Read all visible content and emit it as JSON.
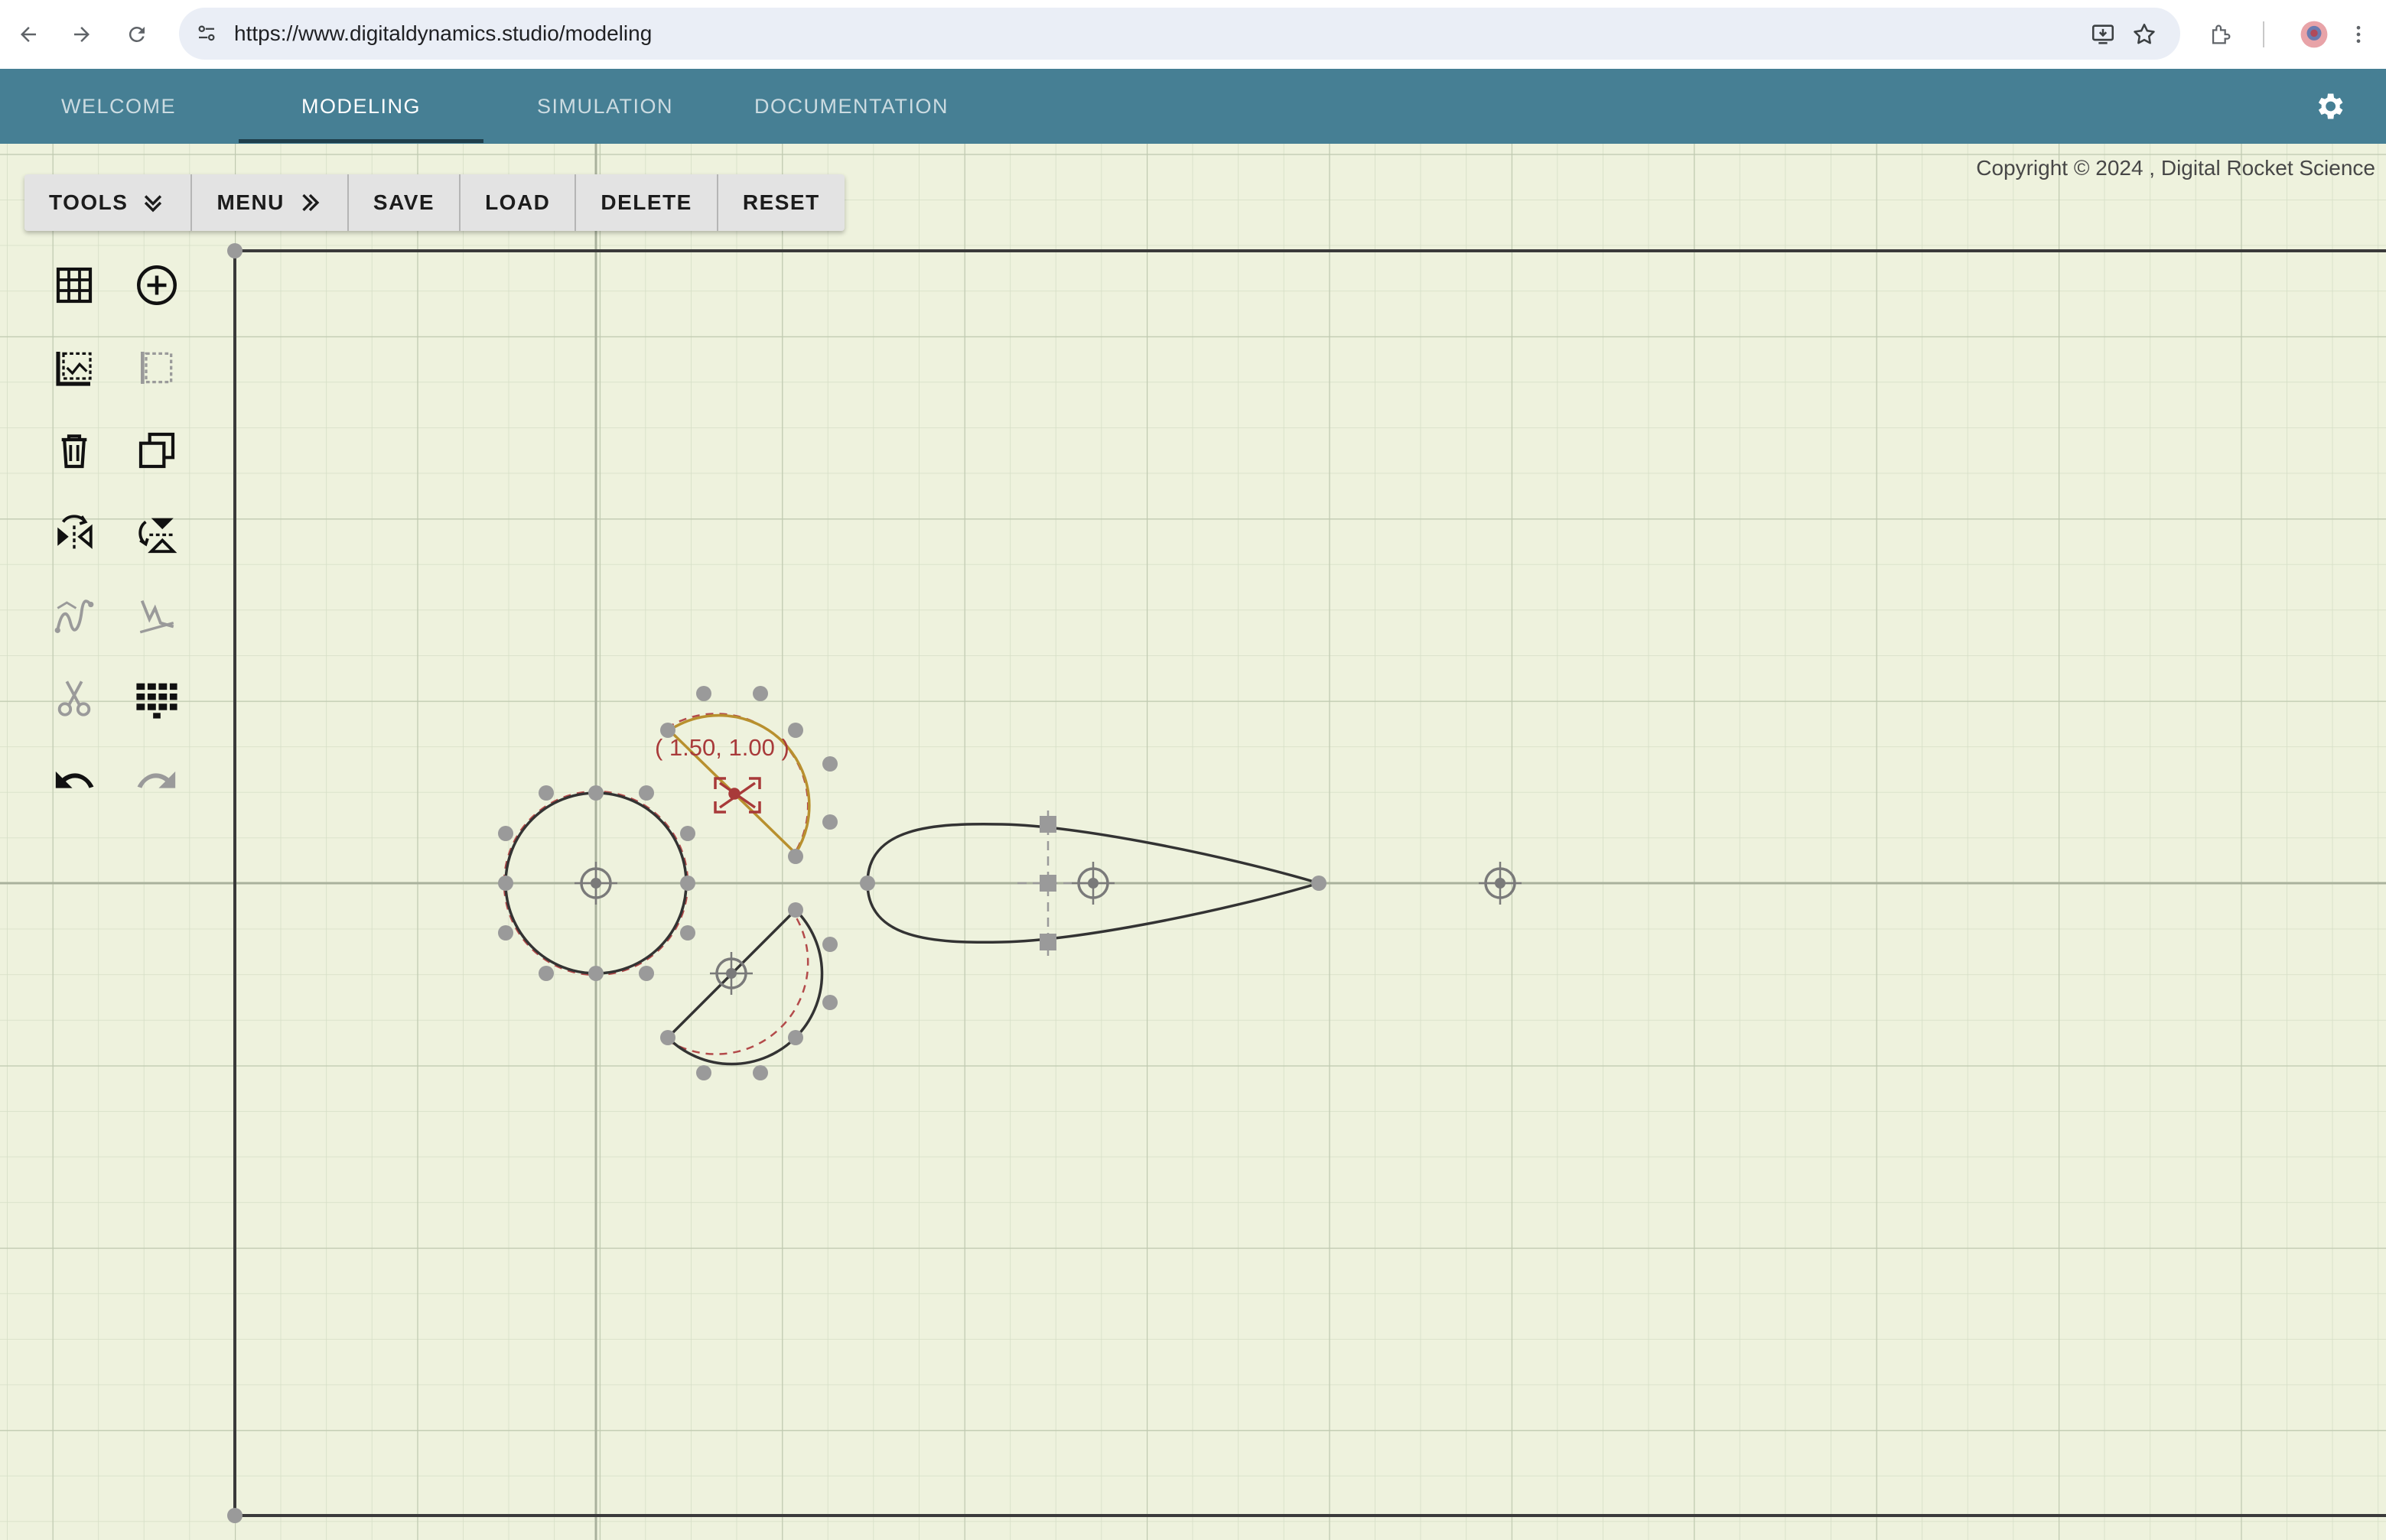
{
  "browser": {
    "url": "https://www.digitaldynamics.studio/modeling",
    "icons": [
      "back-arrow-icon",
      "forward-arrow-icon",
      "reload-icon",
      "site-settings-icon",
      "install-app-icon",
      "bookmark-star-icon",
      "extensions-icon",
      "profile-avatar-icon",
      "more-vert-icon"
    ]
  },
  "nav": {
    "tabs": [
      {
        "label": "WELCOME",
        "active": false
      },
      {
        "label": "MODELING",
        "active": true
      },
      {
        "label": "SIMULATION",
        "active": false
      },
      {
        "label": "DOCUMENTATION",
        "active": false
      }
    ],
    "settings_icon": "gear-icon"
  },
  "copyright": "Copyright © 2024 , Digital Rocket Science",
  "toolbar": {
    "tools_label": "TOOLS",
    "menu_label": "MENU",
    "save_label": "SAVE",
    "load_label": "LOAD",
    "delete_label": "DELETE",
    "reset_label": "RESET"
  },
  "palette": {
    "tools": [
      {
        "name": "grid-icon",
        "enabled": true
      },
      {
        "name": "add-circle-icon",
        "enabled": true
      },
      {
        "name": "select-area-icon",
        "enabled": true
      },
      {
        "name": "deselect-area-icon",
        "enabled": false
      },
      {
        "name": "trash-icon",
        "enabled": true
      },
      {
        "name": "duplicate-icon",
        "enabled": true
      },
      {
        "name": "flip-horizontal-icon",
        "enabled": true
      },
      {
        "name": "flip-vertical-icon",
        "enabled": true
      },
      {
        "name": "spline-icon",
        "enabled": false
      },
      {
        "name": "polyline-icon",
        "enabled": false
      },
      {
        "name": "scissors-icon",
        "enabled": false
      },
      {
        "name": "keypad-icon",
        "enabled": true
      },
      {
        "name": "undo-icon",
        "enabled": true
      },
      {
        "name": "redo-icon",
        "enabled": false
      }
    ]
  },
  "canvas": {
    "coordinate_readout": "( 1.50, 1.00 )",
    "colors": {
      "background": "#eef2dd",
      "grid_minor": "#d3dcc5",
      "grid_major": "#bcc6ac",
      "shape_stroke": "#333333",
      "selected_stroke": "#b8902e",
      "handle": "#9a9a9a",
      "highlight_dash": "#b34a4a"
    }
  }
}
